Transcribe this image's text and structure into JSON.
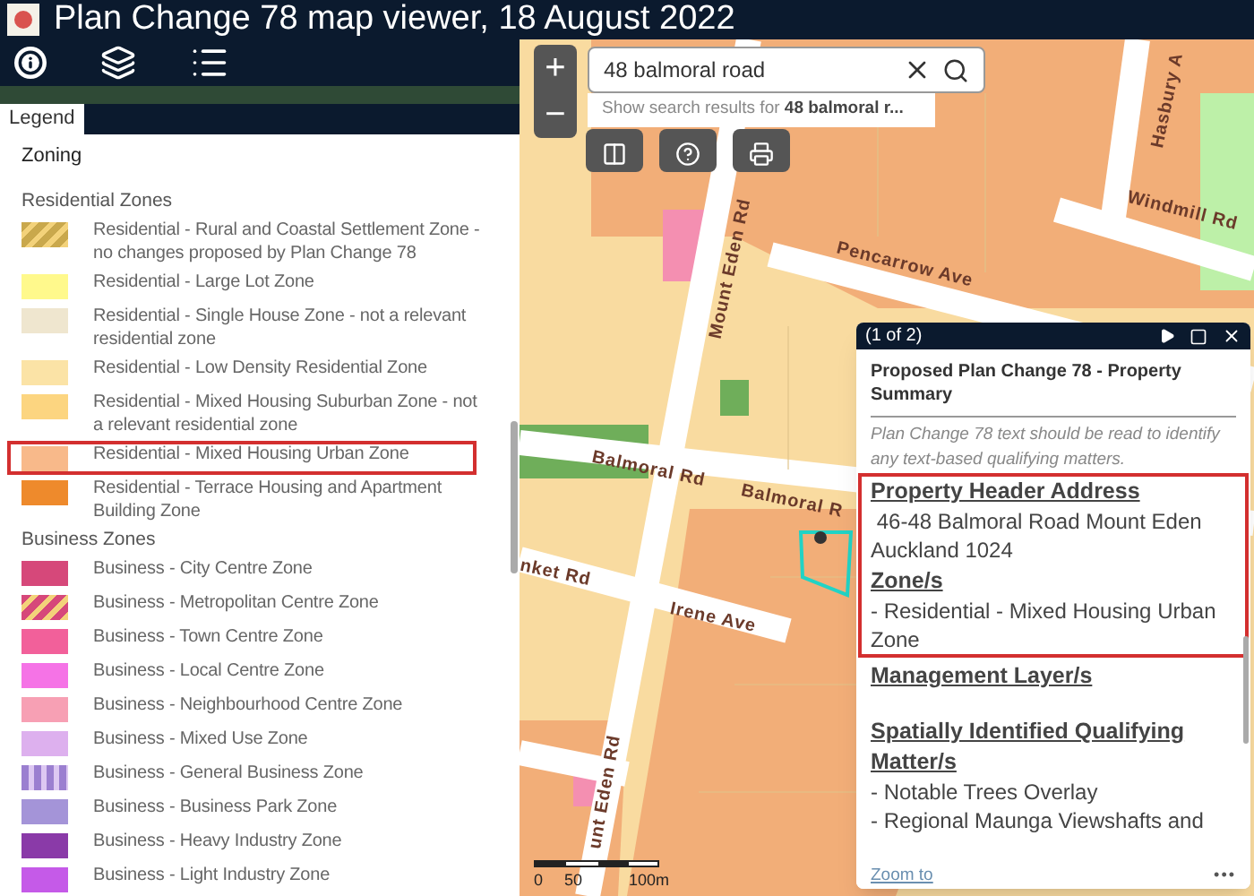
{
  "header": {
    "title": "Plan Change 78 map viewer, 18 August 2022"
  },
  "legend": {
    "tab": "Legend",
    "heading": "Zoning",
    "groups": [
      {
        "title": "Residential Zones",
        "items": [
          {
            "label": "Residential - Rural and Coastal Settlement Zone - no changes proposed by Plan Change 78",
            "color": "#c9a84c",
            "kind": "hatched",
            "highlighted": false
          },
          {
            "label": "Residential - Large Lot Zone",
            "color": "#fff98c",
            "kind": "solid",
            "highlighted": false
          },
          {
            "label": "Residential - Single House Zone - not a relevant residential zone",
            "color": "#efe6cf",
            "kind": "solid",
            "highlighted": false
          },
          {
            "label": "Residential - Low Density Residential Zone",
            "color": "#fbe3a6",
            "kind": "solid",
            "highlighted": false
          },
          {
            "label": "Residential - Mixed Housing Suburban Zone - not a relevant residential zone",
            "color": "#fcd580",
            "kind": "solid",
            "highlighted": false
          },
          {
            "label": "Residential - Mixed Housing Urban Zone",
            "color": "#f8b98a",
            "kind": "solid",
            "highlighted": true
          },
          {
            "label": "Residential - Terrace Housing and Apartment Building Zone",
            "color": "#ee8a2c",
            "kind": "solid",
            "highlighted": false
          }
        ]
      },
      {
        "title": "Business Zones",
        "items": [
          {
            "label": "Business - City Centre Zone",
            "color": "#d6487a",
            "kind": "solid",
            "highlighted": false
          },
          {
            "label": "Business - Metropolitan Centre Zone",
            "color": "#d6487a",
            "kind": "hatched",
            "highlighted": false
          },
          {
            "label": "Business - Town Centre Zone",
            "color": "#f2609a",
            "kind": "solid",
            "highlighted": false
          },
          {
            "label": "Business - Local Centre Zone",
            "color": "#f573e6",
            "kind": "solid",
            "highlighted": false
          },
          {
            "label": "Business - Neighbourhood Centre Zone",
            "color": "#f7a0b4",
            "kind": "solid",
            "highlighted": false
          },
          {
            "label": "Business - Mixed Use Zone",
            "color": "#ddb0ee",
            "kind": "solid",
            "highlighted": false
          },
          {
            "label": "Business - General Business Zone",
            "color": "#9b7fd0",
            "kind": "striped",
            "highlighted": false
          },
          {
            "label": "Business - Business Park Zone",
            "color": "#a494d8",
            "kind": "solid",
            "highlighted": false
          },
          {
            "label": "Business - Heavy Industry Zone",
            "color": "#8a3aa8",
            "kind": "solid",
            "highlighted": false
          },
          {
            "label": "Business - Light Industry Zone",
            "color": "#c55ae8",
            "kind": "solid",
            "highlighted": false
          }
        ]
      }
    ]
  },
  "map": {
    "zoom_in": "+",
    "zoom_out": "−",
    "search": {
      "value": "48 balmoral road",
      "suggestion": "Show search results for **48 balmoral r...**"
    },
    "street_labels": [
      "Hasbury A",
      "Mount Eden Rd",
      "Pencarrow Ave",
      "Windmill Rd",
      "Balmoral Rd",
      "Balmoral R",
      "nket Rd",
      "Irene Ave",
      "unt Eden Rd"
    ],
    "scale": [
      "0",
      "50",
      "100m"
    ]
  },
  "popup": {
    "counter": "(1 of 2)",
    "title": "Proposed Plan Change 78 - Property Summary",
    "note": "Plan Change 78 text should be read to identify any text-based qualifying matters.",
    "blocks": [
      {
        "kind": "highlight_box",
        "sections": [
          {
            "heading": "Property Header Address",
            "lines": [
              " 46-48 Balmoral Road Mount Eden Auckland 1024"
            ]
          },
          {
            "heading": "Zone/s",
            "lines": [
              "- Residential - Mixed Housing Urban Zone"
            ]
          }
        ]
      },
      {
        "kind": "plain",
        "sections": [
          {
            "heading": "Management Layer/s"
          },
          {
            "heading": "Spatially Identified Qualifying Matter/s",
            "lines": [
              "- Notable Trees Overlay",
              "- Regional Maunga Viewshafts and"
            ]
          }
        ]
      }
    ],
    "link": "Zoom to",
    "more": "•••"
  }
}
